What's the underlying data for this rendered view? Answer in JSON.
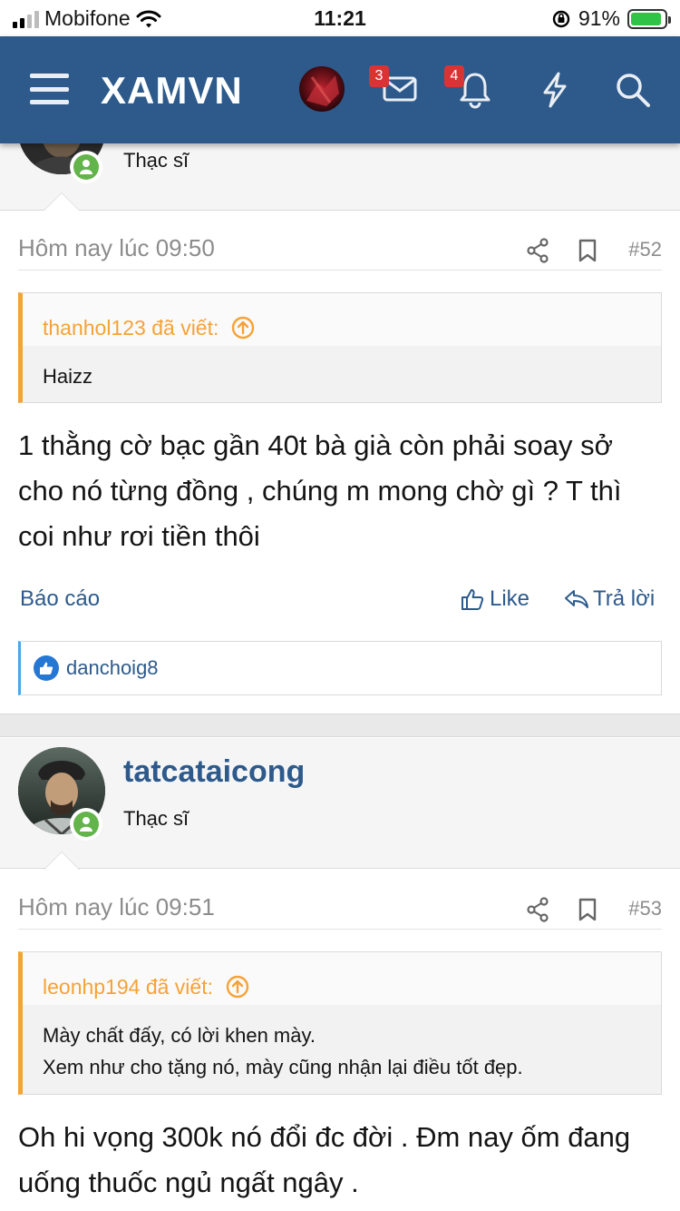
{
  "status_bar": {
    "carrier": "Mobifone",
    "time": "11:21",
    "battery": "91%",
    "battery_level": 0.91
  },
  "header": {
    "logo": "XAMVN",
    "inbox_badge": "3",
    "alerts_badge": "4",
    "icons": [
      "menu-icon",
      "envelope-icon",
      "bell-icon",
      "lightning-icon",
      "search-icon"
    ]
  },
  "prev_user": {
    "title": "Thạc sĩ"
  },
  "posts": [
    {
      "date": "Hôm nay lúc 09:50",
      "number": "#52",
      "quote": {
        "author": "thanhol123 đã viết:",
        "lines": [
          "Haizz"
        ]
      },
      "body": "1 thằng cờ bạc gần 40t bà già còn phải soay sở cho nó từng đồng , chúng m mong chờ gì ? T thì coi như rơi tiền thôi",
      "actions": {
        "report": "Báo cáo",
        "like": "Like",
        "reply": "Trả lời"
      },
      "reaction_users": "danchoig8"
    },
    {
      "username": "tatcataicong",
      "user_title": "Thạc sĩ",
      "date": "Hôm nay lúc 09:51",
      "number": "#53",
      "quote": {
        "author": "leonhp194 đã viết:",
        "lines": [
          "Mày chất đấy, có lời khen mày.",
          "Xem như cho tặng nó, mày cũng nhận lại điều tốt đẹp."
        ]
      },
      "body": "Oh hi vọng 300k nó đổi đc đời . Đm nay ốm đang uống thuốc ngủ ngất ngây ."
    }
  ],
  "colors": {
    "header_bg": "#2d5a8b",
    "link": "#2d5a8b",
    "quote_accent": "#f6a236",
    "online": "#63b44b",
    "badge": "#d93434"
  }
}
